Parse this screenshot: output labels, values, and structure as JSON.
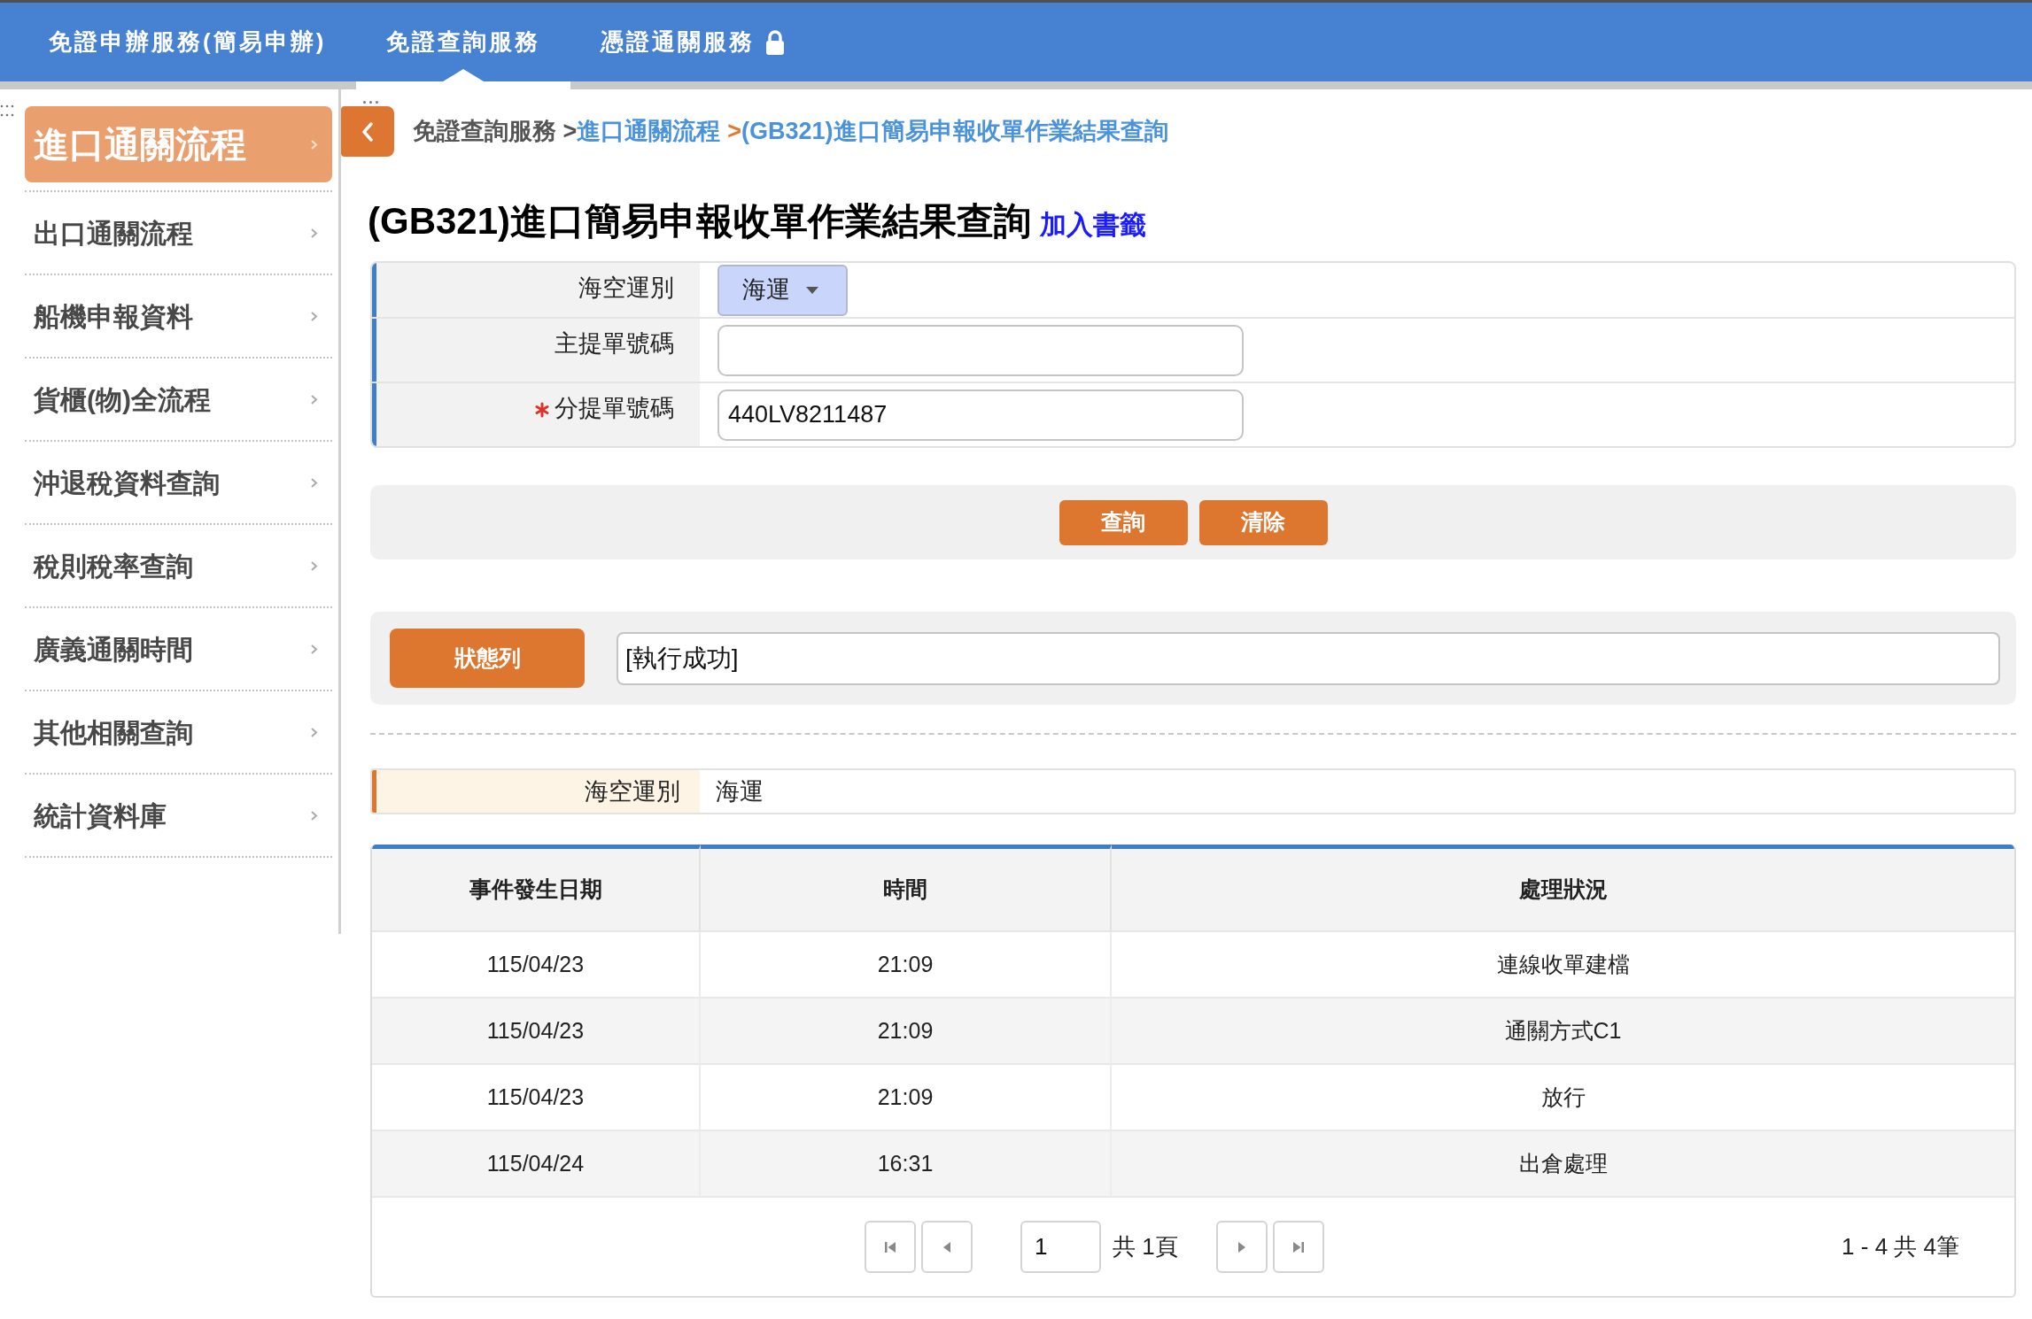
{
  "top_nav": {
    "tabs": [
      {
        "label": "免證申辦服務(簡易申辦)",
        "selected": false,
        "locked": false
      },
      {
        "label": "免證查詢服務",
        "selected": true,
        "locked": false
      },
      {
        "label": "憑證通關服務",
        "selected": false,
        "locked": true
      }
    ]
  },
  "sidebar": {
    "items": [
      {
        "label": "進口通關流程",
        "selected": true
      },
      {
        "label": "出口通關流程",
        "selected": false
      },
      {
        "label": "船機申報資料",
        "selected": false
      },
      {
        "label": "貨櫃(物)全流程",
        "selected": false
      },
      {
        "label": "沖退稅資料查詢",
        "selected": false
      },
      {
        "label": "稅則稅率查詢",
        "selected": false
      },
      {
        "label": "廣義通關時間",
        "selected": false
      },
      {
        "label": "其他相關查詢",
        "selected": false
      },
      {
        "label": "統計資料庫",
        "selected": false
      }
    ]
  },
  "breadcrumb": [
    {
      "label": "免證查詢服務 >",
      "kind": "plain"
    },
    {
      "label": "進口通關流程",
      "kind": "link"
    },
    {
      "label": ">",
      "kind": "separator"
    },
    {
      "label": "(GB321)進口簡易申報收單作業結果查詢",
      "kind": "link"
    }
  ],
  "page_title": "(GB321)進口簡易申報收單作業結果查詢",
  "bookmark_link": "加入書籤",
  "query_form": {
    "fields": [
      {
        "label": "海空運別",
        "kind": "select",
        "value": "海運",
        "required": false
      },
      {
        "label": "主提單號碼",
        "kind": "text",
        "required": false
      },
      {
        "label": "分提單號碼",
        "kind": "text",
        "value": "440LV8211487",
        "required": true
      }
    ]
  },
  "actions": [
    "查詢",
    "清除"
  ],
  "status_bar": {
    "label": "狀態列",
    "value": "[執行成功]"
  },
  "result_fields": [
    {
      "label": "海空運別",
      "value": "海運"
    }
  ],
  "table": {
    "columns": [
      "事件發生日期",
      "時間",
      "處理狀況"
    ],
    "rows": [
      [
        "115/04/23",
        "21:09",
        "連線收單建檔"
      ],
      [
        "115/04/23",
        "21:09",
        "通關方式C1"
      ],
      [
        "115/04/23",
        "21:09",
        "放行"
      ],
      [
        "115/04/24",
        "16:31",
        "出倉處理"
      ]
    ]
  },
  "pagination": {
    "page": "1",
    "total_pages": "共 1頁",
    "summary": "1 - 4 共 4筆"
  }
}
